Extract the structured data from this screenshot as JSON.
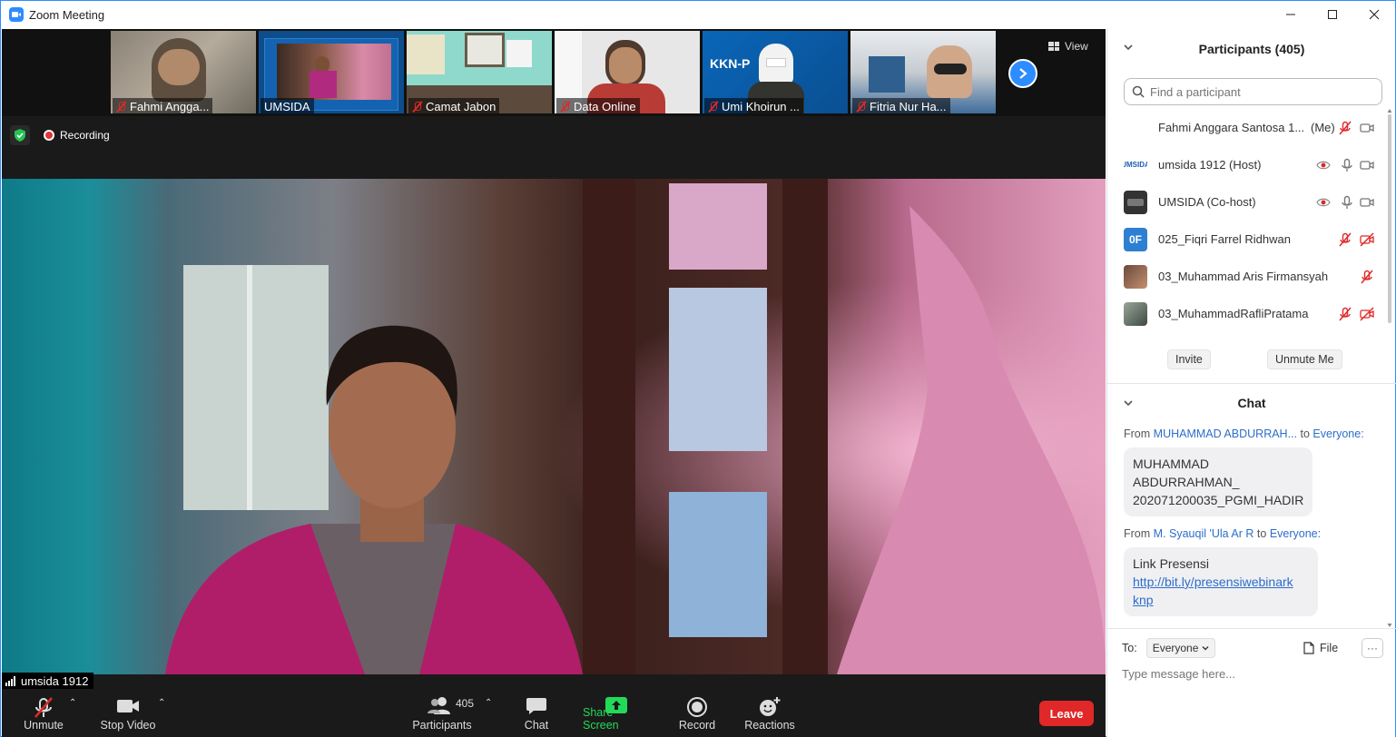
{
  "window": {
    "title": "Zoom Meeting"
  },
  "thumbnails": [
    {
      "name": "Fahmi Angga...",
      "muted": true
    },
    {
      "name": "UMSIDA",
      "muted": false
    },
    {
      "name": "Camat Jabon",
      "muted": true
    },
    {
      "name": "Data Online",
      "muted": true
    },
    {
      "name": "Umi Khoirun ...",
      "muted": true
    },
    {
      "name": "Fitria Nur Ha...",
      "muted": true
    }
  ],
  "view_label": "View",
  "recording_label": "Recording",
  "active_speaker": "umsida 1912",
  "toolbar": {
    "unmute": "Unmute",
    "stop_video": "Stop Video",
    "participants_count": "405",
    "participants": "Participants",
    "chat": "Chat",
    "share_screen": "Share Screen",
    "record": "Record",
    "reactions": "Reactions",
    "leave": "Leave"
  },
  "participants_panel": {
    "title": "Participants (405)",
    "search_placeholder": "Find a participant",
    "participants": [
      {
        "name": "Fahmi Anggara Santosa 1...",
        "role": "(Me)",
        "avatar": "",
        "mic": "muted",
        "video": "on"
      },
      {
        "name": "umsida 1912 (Host)",
        "avatar": "UMSIDA",
        "mic": "on",
        "video": "on"
      },
      {
        "name": "UMSIDA (Co-host)",
        "avatar": "",
        "mic": "on",
        "video": "on"
      },
      {
        "name": "025_Fiqri Farrel Ridhwan",
        "avatar": "0F",
        "mic": "muted",
        "video": "off"
      },
      {
        "name": "03_Muhammad Aris Firmansyah",
        "avatar": "",
        "mic": "muted",
        "video": "none"
      },
      {
        "name": "03_MuhammadRafliPratama",
        "avatar": "",
        "mic": "muted",
        "video": "off"
      }
    ],
    "invite": "Invite",
    "unmute_me": "Unmute Me"
  },
  "chat_panel": {
    "title": "Chat",
    "messages": [
      {
        "from_label": "From",
        "sender": "MUHAMMAD ABDURRAH...",
        "to_label": "to",
        "recipient": "Everyone:",
        "lines": [
          "MUHAMMAD",
          "ABDURRAHMAN_",
          "202071200035_PGMI_HADIR"
        ]
      },
      {
        "from_label": "From",
        "sender": "M. Syauqil 'Ula Ar R",
        "to_label": "to",
        "recipient": "Everyone:",
        "text": "Link Presensi",
        "link_lines": [
          "http://bit.ly/presensiwebinark",
          "knp"
        ]
      }
    ],
    "to_label": "To:",
    "to_value": "Everyone",
    "file_label": "File",
    "more_label": "···",
    "input_placeholder": "Type message here..."
  },
  "colors": {
    "accent": "#2d8cff",
    "leave": "#e02828",
    "share": "#23d959",
    "link": "#2d6ec9"
  }
}
